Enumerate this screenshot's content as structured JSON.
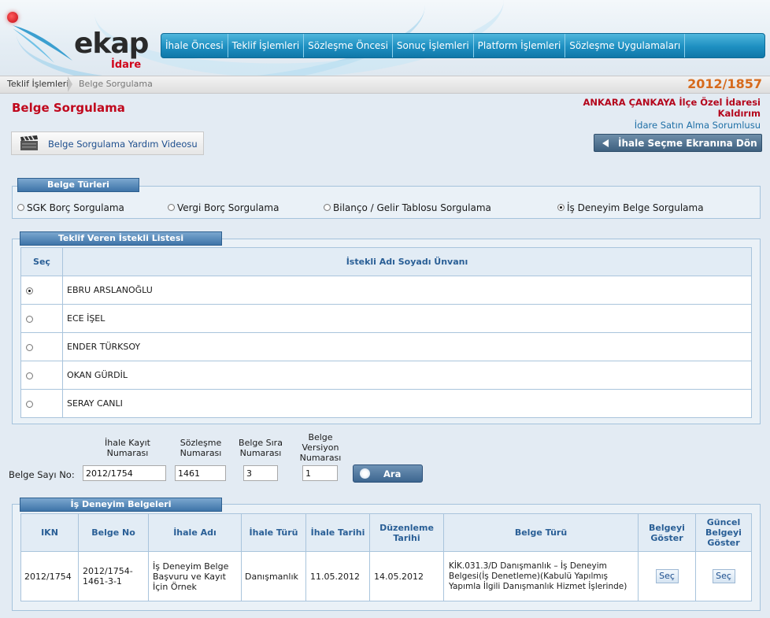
{
  "header": {
    "logo_text": "ekap",
    "logo_sub": "İdare",
    "nav": [
      "İhale Öncesi",
      "Teklif İşlemleri",
      "Sözleşme Öncesi",
      "Sonuç İşlemleri",
      "Platform İşlemleri",
      "Sözleşme Uygulamaları"
    ]
  },
  "breadcrumb": {
    "items": [
      "Teklif İşlemleri",
      "Belge Sorgulama"
    ],
    "ikn": "2012/1857"
  },
  "page": {
    "title": "Belge Sorgulama",
    "org_name": "ANKARA ÇANKAYA İlçe Özel İdaresi Kaldırım",
    "org_role": "İdare Satın Alma Sorumlusu",
    "help_video": "Belge Sorgulama Yardım Videosu",
    "back_button": "İhale Seçme Ekranına Dön"
  },
  "belge_turleri": {
    "legend": "Belge Türleri",
    "options": [
      "SGK Borç Sorgulama",
      "Vergi Borç Sorgulama",
      "Bilanço / Gelir Tablosu Sorgulama",
      "İş Deneyim Belge Sorgulama"
    ],
    "selected": "İş Deneyim Belge Sorgulama"
  },
  "istekli": {
    "legend": "Teklif Veren İstekli Listesi",
    "columns": [
      "Seç",
      "İstekli Adı Soyadı Ünvanı"
    ],
    "rows": [
      "EBRU ARSLANOĞLU",
      "ECE İŞEL",
      "ENDER TÜRKSOY",
      "OKAN GÜRDİL",
      "SERAY CANLI"
    ],
    "selected": "EBRU ARSLANOĞLU"
  },
  "search": {
    "label": "Belge Sayı No:",
    "ihale_kayit_label": "İhale Kayıt Numarası",
    "sozlesme_label": "Sözleşme Numarası",
    "sira_label": "Belge Sıra Numarası",
    "versiyon_label": "Belge Versiyon Numarası",
    "ihale_kayit_value": "2012/1754",
    "sozlesme_value": "1461",
    "sira_value": "3",
    "versiyon_value": "1",
    "button": "Ara"
  },
  "belgeler": {
    "legend": "İş Deneyim Belgeleri",
    "columns": [
      "IKN",
      "Belge No",
      "İhale Adı",
      "İhale Türü",
      "İhale Tarihi",
      "Düzenleme Tarihi",
      "Belge Türü",
      "Belgeyi Göster",
      "Güncel Belgeyi Göster"
    ],
    "rows": [
      {
        "ikn": "2012/1754",
        "belge_no": "2012/1754-1461-3-1",
        "ihale_adi": "İş Deneyim Belge Başvuru ve Kayıt İçin Örnek",
        "ihale_turu": "Danışmanlık",
        "ihale_tarihi": "11.05.2012",
        "duzenleme_tarihi": "14.05.2012",
        "belge_turu": "KİK.031.3/D Danışmanlık – İş Deneyim Belgesi(İş Denetleme)(Kabulü Yapılmış Yapımla İlgili Danışmanlık Hizmet İşlerinde)",
        "goster": "Seç",
        "guncel_goster": "Seç"
      }
    ]
  },
  "colors": {
    "nav": "#1d8fc1",
    "title_red": "#c0081d",
    "ikn_orange": "#d66a1c",
    "panel_border": "#a5c3dc"
  }
}
